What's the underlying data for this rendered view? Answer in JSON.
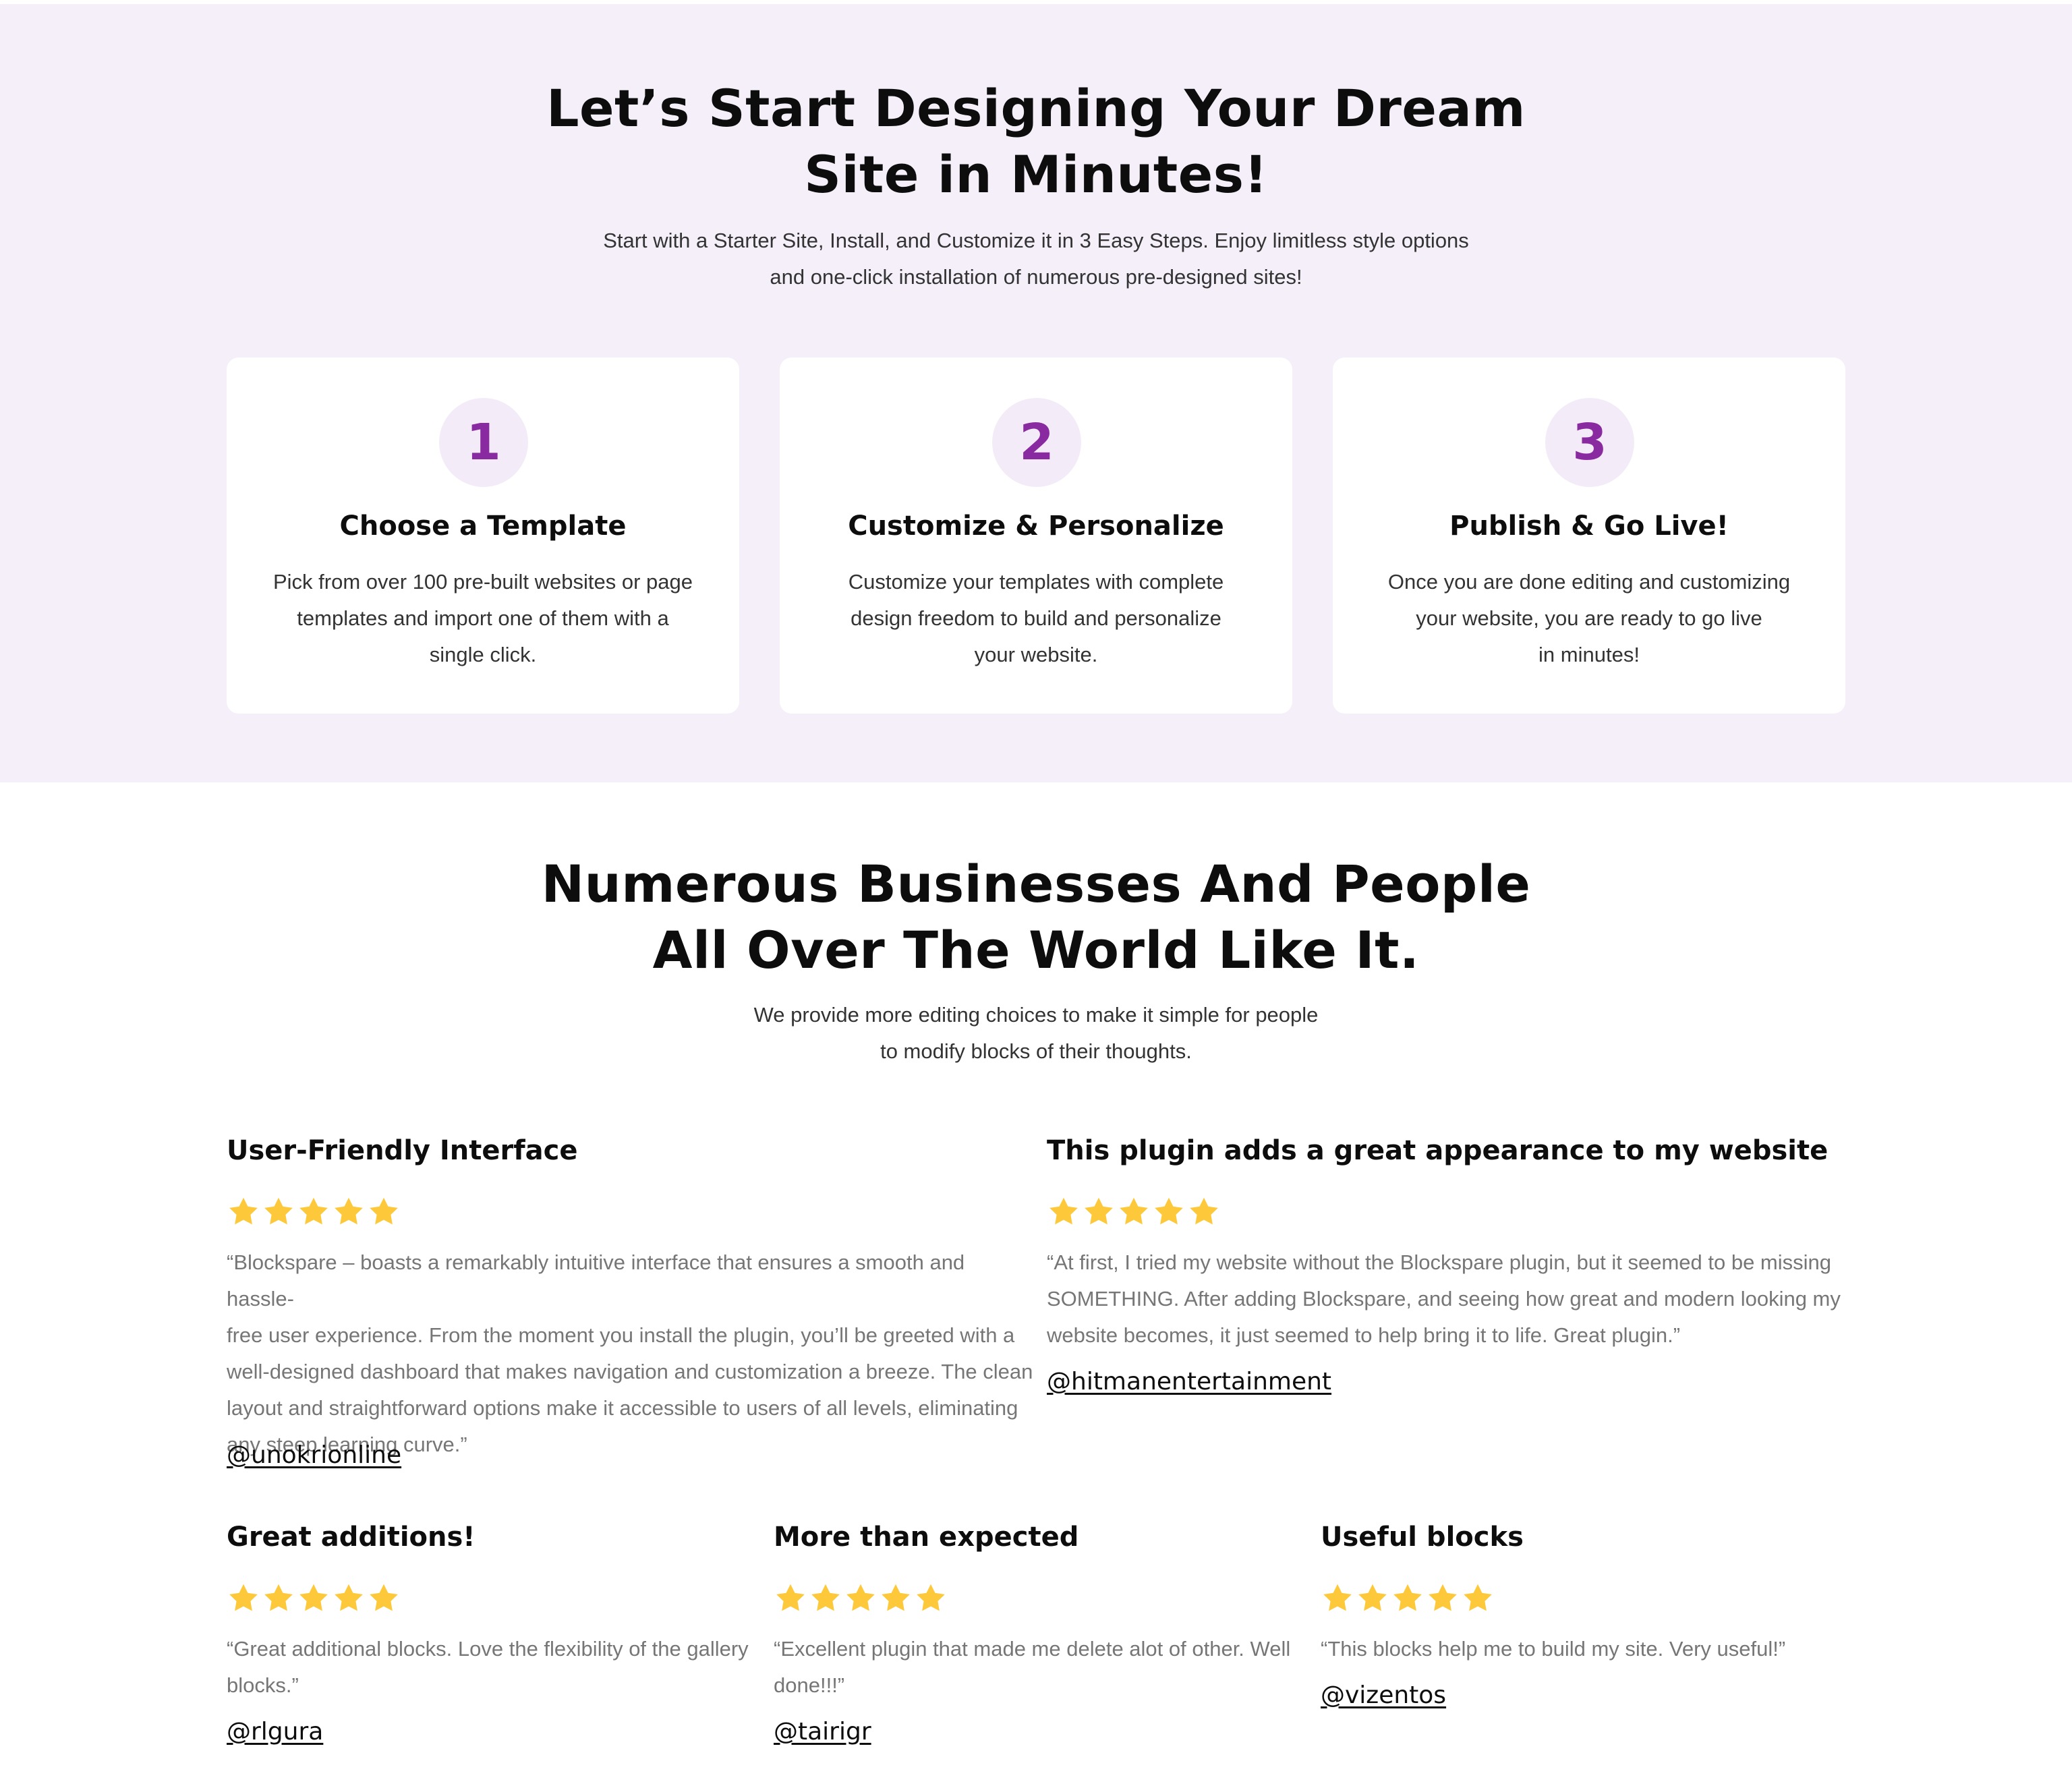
{
  "colors": {
    "section_bg": "#f5eff9",
    "accent_purple": "#8a2aa0",
    "number_circle_bg": "#f3ecf8",
    "star_yellow": "#fdc93a",
    "heading_text": "#0d0d0d",
    "quote_text": "#767676"
  },
  "steps": {
    "heading_line1": "Let’s Start Designing Your Dream",
    "heading_line2": "Site in Minutes!",
    "sub_line1": "Start with a Starter Site, Install, and Customize it in 3 Easy Steps. Enjoy limitless style options",
    "sub_line2": "and one-click installation of numerous pre-designed sites!",
    "cards": [
      {
        "number": "1",
        "title": "Choose a Template",
        "desc_lines": [
          "Pick from over 100 pre-built websites or page",
          "templates and import one of them with a",
          "single click."
        ]
      },
      {
        "number": "2",
        "title": "Customize & Personalize",
        "desc_lines": [
          "Customize your templates with complete",
          "design freedom to build and personalize",
          "your website."
        ]
      },
      {
        "number": "3",
        "title": "Publish & Go Live!",
        "desc_lines": [
          "Once you are done editing and customizing",
          "your website, you are ready to go live",
          "in minutes!"
        ]
      }
    ]
  },
  "testimonials": {
    "heading_line1": "Numerous Businesses And People",
    "heading_line2": "All Over The World Like It.",
    "sub_line1": "We provide more editing choices to make it simple for people",
    "sub_line2": "to modify blocks of their thoughts.",
    "rating_icon": "star-icon",
    "items": [
      {
        "title": "User-Friendly Interface",
        "rating": 5,
        "quote_lines": [
          "“Blockspare – boasts a remarkably intuitive interface that ensures a smooth and hassle-",
          "free user experience. From the moment you install the plugin, you’ll be greeted with a",
          "well-designed dashboard that makes navigation and customization a breeze. The clean",
          "layout and straightforward options make it accessible to users of all levels, eliminating",
          "any steep learning curve.”"
        ],
        "handle": "@unokrionline"
      },
      {
        "title": "This plugin adds a great appearance to my website",
        "rating": 5,
        "quote_lines": [
          "“At first, I tried my website without the Blockspare plugin, but it seemed to be missing",
          "SOMETHING. After adding Blockspare, and seeing how great and modern looking my",
          "website becomes, it just seemed to help bring it to life. Great plugin.”"
        ],
        "handle": "@hitmanentertainment"
      },
      {
        "title": "Great additions!",
        "rating": 5,
        "quote_lines": [
          "“Great additional blocks. Love the flexibility of the gallery",
          "blocks.”"
        ],
        "handle": "@rlgura"
      },
      {
        "title": "More than expected",
        "rating": 5,
        "quote_lines": [
          "“Excellent plugin that made me delete alot of other. Well",
          "done!!!”"
        ],
        "handle": "@tairigr"
      },
      {
        "title": "Useful blocks",
        "rating": 5,
        "quote_lines": [
          "“This blocks help me to build my site. Very useful!”"
        ],
        "handle": "@vizentos"
      }
    ]
  }
}
